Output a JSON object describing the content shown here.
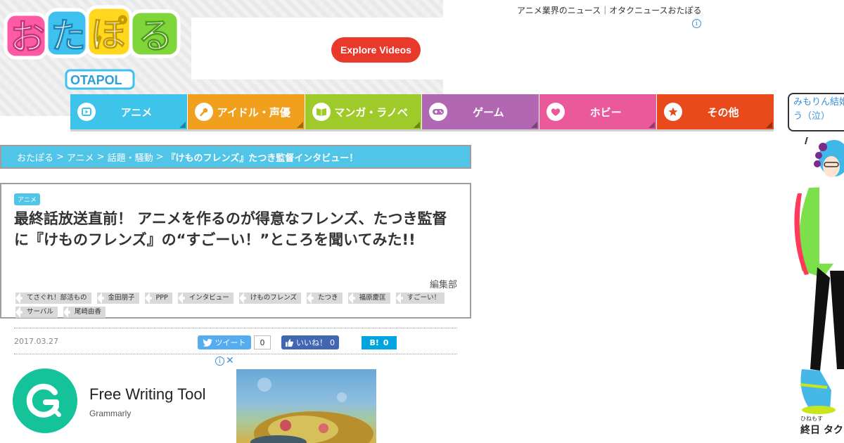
{
  "header": {
    "logo_text": "おたぽる",
    "logo_subtext": "OTAPOL",
    "tagline": "アニメ業界のニュース｜オタクニュースおたぽる",
    "ad_button_label": "Explore Videos"
  },
  "nav": {
    "items": [
      {
        "label": "アニメ",
        "color": "#3ec3ea",
        "icon": "play-icon"
      },
      {
        "label": "アイドル・声優",
        "color": "#f0a01c",
        "icon": "microphone-icon"
      },
      {
        "label": "マンガ・ラノベ",
        "color": "#9fcb2a",
        "icon": "book-icon"
      },
      {
        "label": "ゲーム",
        "color": "#b267b3",
        "icon": "gamepad-icon"
      },
      {
        "label": "ホビー",
        "color": "#ea5a9a",
        "icon": "heart-icon"
      },
      {
        "label": "その他",
        "color": "#e84a1c",
        "icon": "star-icon"
      }
    ]
  },
  "breadcrumb": {
    "items": [
      "おたぽる",
      ">",
      "アニメ",
      ">",
      "話題・騒動",
      ">"
    ],
    "current": "『けものフレンズ』たつき監督インタビュー！"
  },
  "article": {
    "category": "アニメ",
    "title": "最終話放送直前！ アニメを作るのが得意なフレンズ、たつき監督に『けものフレンズ』の“すごーい！”ところを聞いてみた!!",
    "author": "編集部",
    "tags": [
      "てさぐれ！部活もの",
      "金田朋子",
      "PPP",
      "インタビュー",
      "けものフレンズ",
      "たつき",
      "福原慶匡",
      "すごーい！",
      "サーバル",
      "尾崎由香"
    ],
    "date": "2017.03.27"
  },
  "share": {
    "tweet_label": "ツイート",
    "tweet_count": "0",
    "like_label": "いいね！",
    "like_count": "0",
    "hatena_label": "B!",
    "hatena_count": "0"
  },
  "ad": {
    "title": "Free Writing Tool",
    "brand": "Grammarly",
    "info_glyph": "ⓘ",
    "close_glyph": "✕"
  },
  "sidebar": {
    "bubble_text": "みもりん結婚おめでとう（泣）",
    "character_ruby": "ひねもす",
    "character_name": "終日 タク"
  },
  "colors": {
    "accent_cyan": "#50c5e8",
    "ad_red": "#e8392a",
    "grammarly_green": "#15c39a"
  }
}
